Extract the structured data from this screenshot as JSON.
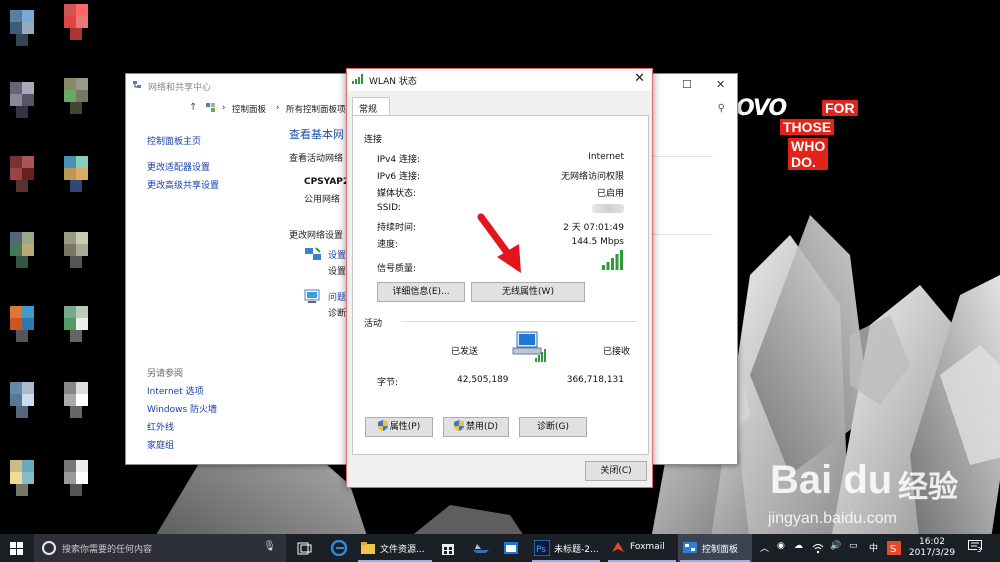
{
  "desktop": {
    "brand": {
      "partial_logo": "OVO",
      "tagline": [
        "FOR",
        "THOSE",
        "WHO DO."
      ]
    },
    "watermark": {
      "logo": "Bai du",
      "logo_cn": "经验",
      "url": "jingyan.baidu.com"
    }
  },
  "control_panel": {
    "title": "网络和共享中心",
    "breadcrumb": [
      "控制面板",
      "所有控制面板项"
    ],
    "left_nav": [
      "控制面板主页",
      "更改适配器设置",
      "更改高级共享设置"
    ],
    "see_also_heading": "另请参阅",
    "see_also": [
      "Internet 选项",
      "Windows 防火墙",
      "红外线",
      "家庭组"
    ],
    "heading": "查看基本网",
    "active_networks": "查看活动网络",
    "network_name": "CPSYAP2",
    "network_type": "公用网络",
    "change_settings": "更改网络设置",
    "setup_link": "设置",
    "setup_desc": "设置",
    "troubleshoot_link": "问题",
    "troubleshoot_desc": "诊断"
  },
  "wlan_dialog": {
    "title": "WLAN 状态",
    "tab": "常规",
    "connection_heading": "连接",
    "rows": [
      {
        "label": "IPv4 连接:",
        "value": "Internet"
      },
      {
        "label": "IPv6 连接:",
        "value": "无网络访问权限"
      },
      {
        "label": "媒体状态:",
        "value": "已启用"
      },
      {
        "label": "SSID:",
        "value": ""
      },
      {
        "label": "持续时间:",
        "value": "2 天 07:01:49"
      },
      {
        "label": "速度:",
        "value": "144.5 Mbps"
      }
    ],
    "signal_label": "信号质量:",
    "signal_bars": 5,
    "details_button": "详细信息(E)...",
    "wireless_button": "无线属性(W)",
    "activity_heading": "活动",
    "sent_label": "已发送",
    "received_label": "已接收",
    "bytes_label": "字节:",
    "bytes_sent": "42,505,189",
    "bytes_received": "366,718,131",
    "properties_button": "属性(P)",
    "disable_button": "禁用(D)",
    "diagnose_button": "诊断(G)",
    "close_button": "关闭(C)"
  },
  "taskbar": {
    "search_placeholder": "搜索你需要的任何内容",
    "items": [
      {
        "label": "文件资源..."
      },
      {
        "label": "未标题-2..."
      },
      {
        "label": "Foxmail"
      },
      {
        "label": "控制面板"
      }
    ],
    "ime": "中",
    "time": "16:02",
    "date": "2017/3/29",
    "notifications": "3"
  },
  "colors": {
    "accent_red": "#e2231a",
    "link_blue": "#1a3ea8",
    "taskbar": "#1b1f26"
  }
}
